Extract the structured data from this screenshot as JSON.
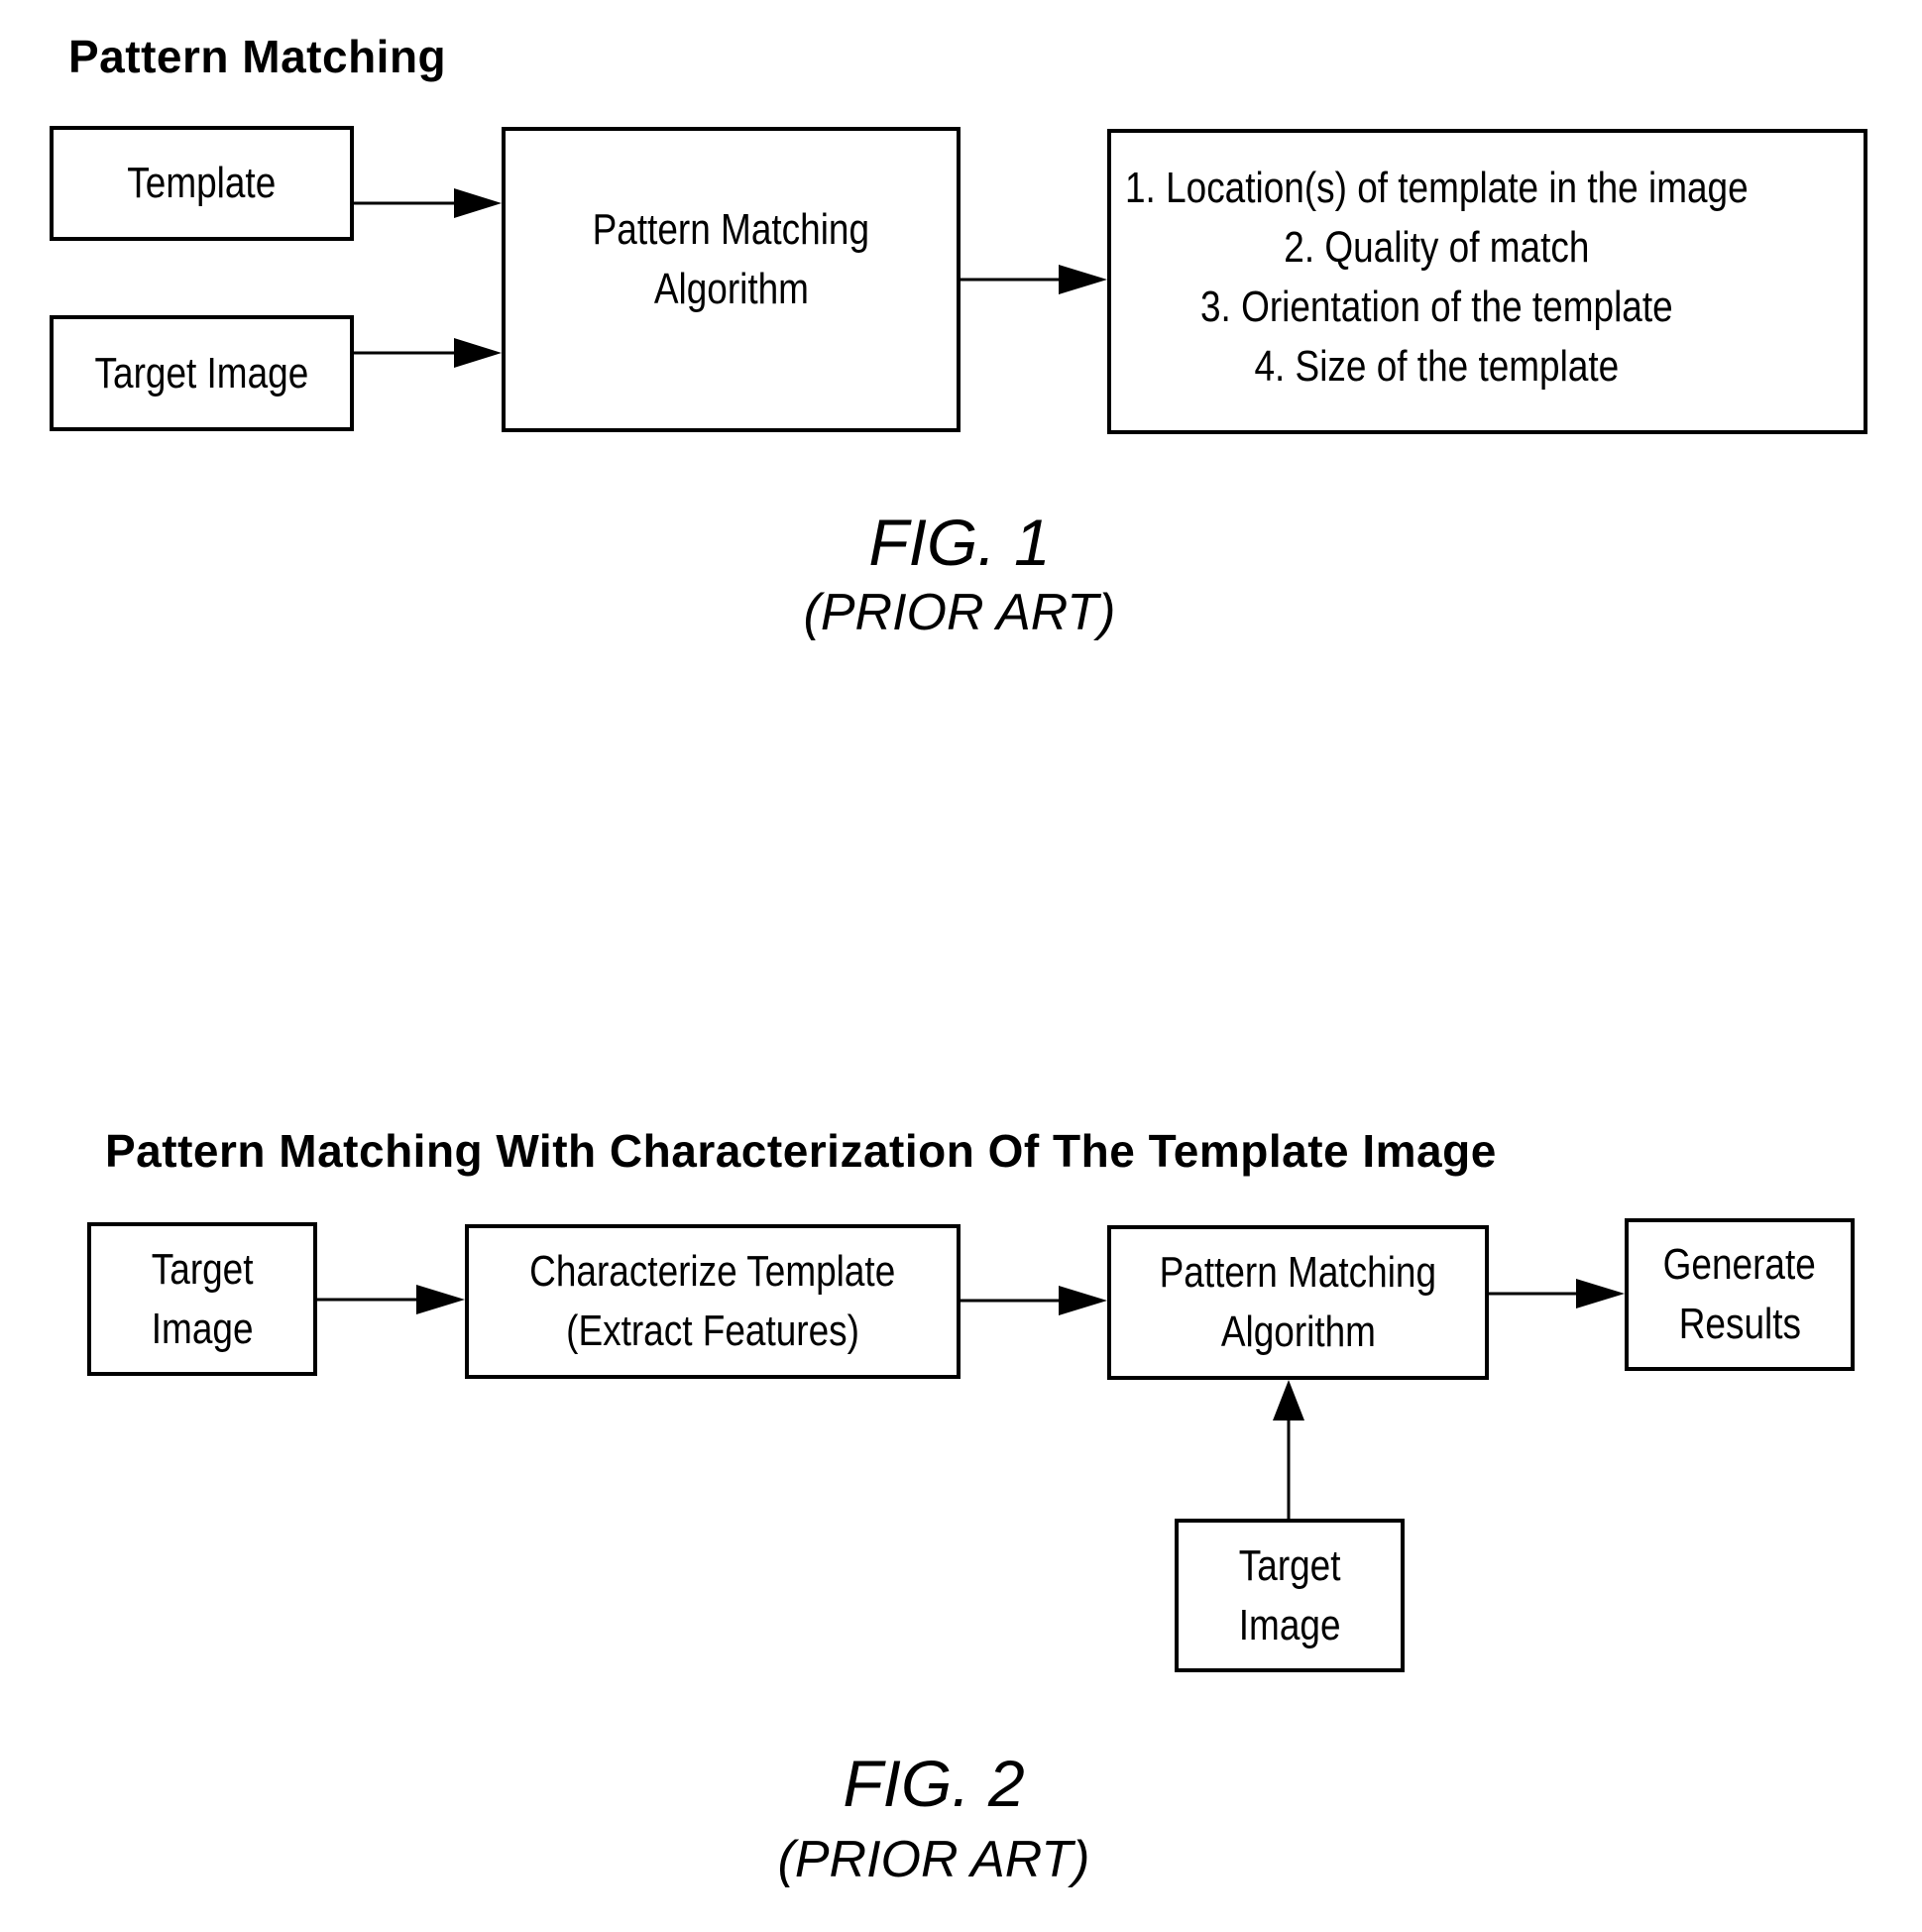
{
  "figure1": {
    "title": "Pattern Matching",
    "inputs": {
      "template": "Template",
      "target_image": "Target Image"
    },
    "algorithm": [
      "Pattern  Matching",
      "Algorithm"
    ],
    "results": [
      "1. Location(s) of template in the image",
      "2. Quality of match",
      "3. Orientation of the template",
      "4. Size of the template"
    ],
    "caption": "FIG. 1",
    "subcaption": "(PRIOR ART)"
  },
  "figure2": {
    "title": "Pattern Matching With Characterization Of The Template Image",
    "target_image_1": [
      "Target",
      "Image"
    ],
    "characterize": [
      "Characterize Template",
      "(Extract Features)"
    ],
    "algorithm": [
      "Pattern Matching",
      "Algorithm"
    ],
    "generate": [
      "Generate",
      "Results"
    ],
    "target_image_2": [
      "Target",
      "Image"
    ],
    "caption": "FIG. 2",
    "subcaption": "(PRIOR ART)"
  }
}
